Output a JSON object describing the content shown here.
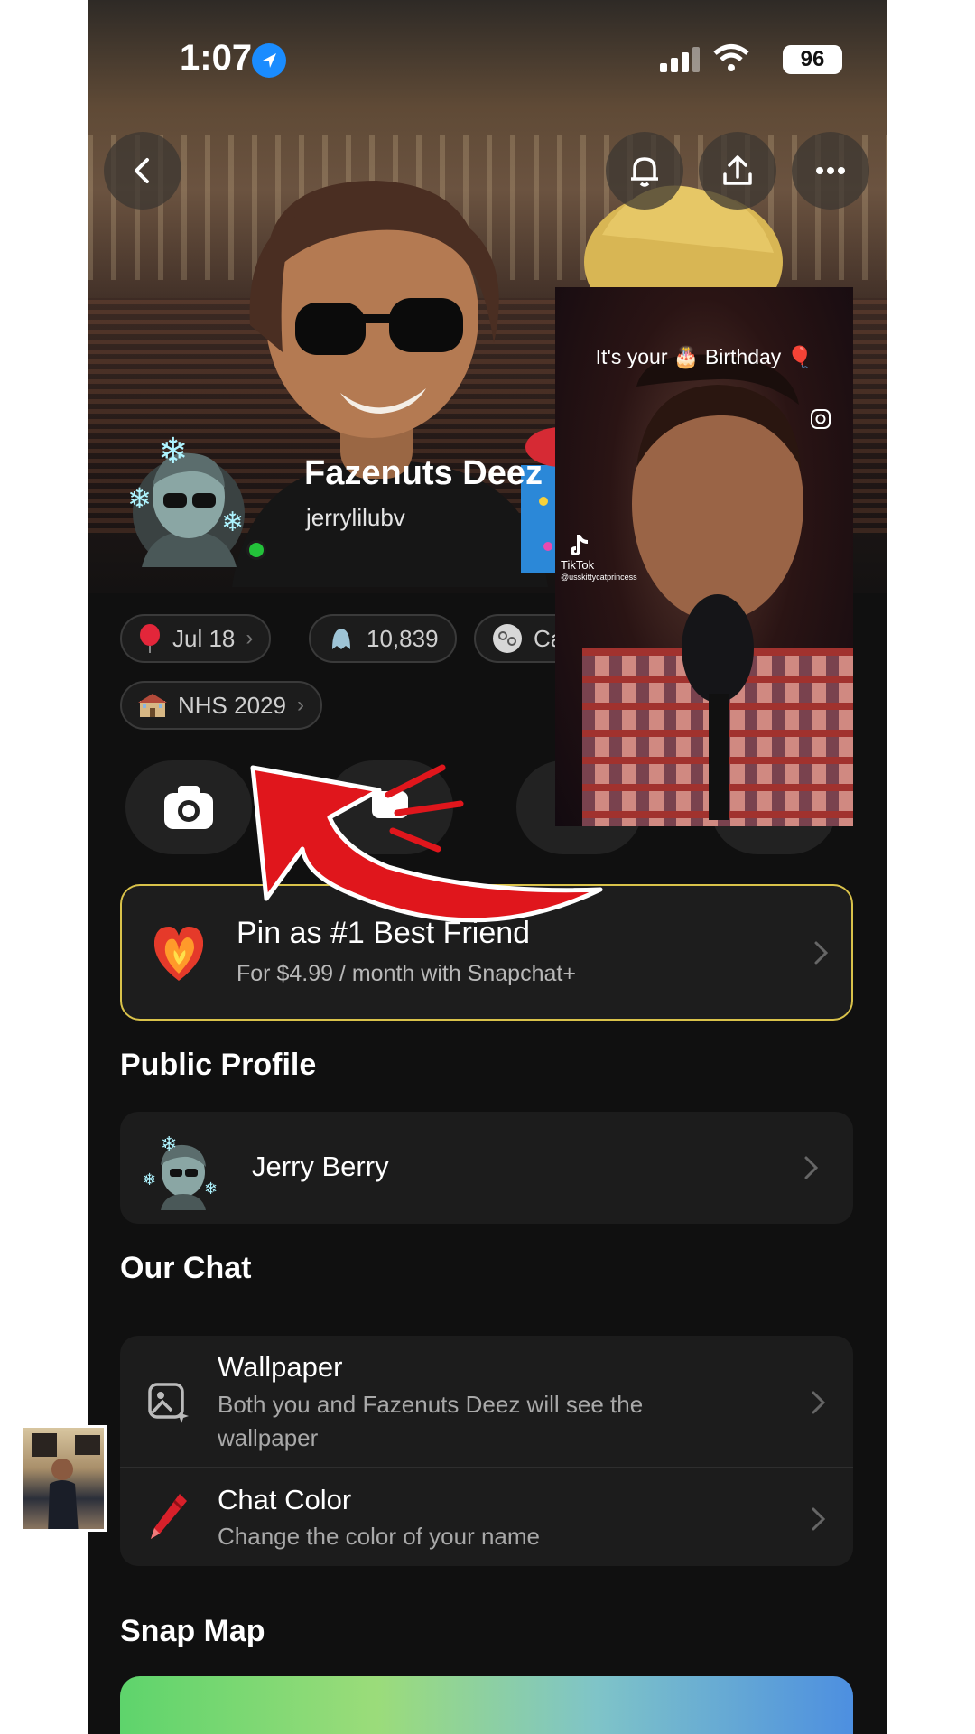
{
  "status_bar": {
    "time": "1:07",
    "battery": "96"
  },
  "profile": {
    "display_name": "Fazenuts Deez",
    "username": "jerrylilubv"
  },
  "chips": {
    "birthday": "Jul 18",
    "score": "10,839",
    "zodiac": "Ca",
    "school": "NHS 2029"
  },
  "snapchat_plus": {
    "title": "Pin as #1 Best Friend",
    "subtitle": "For $4.99 / month with Snapchat+"
  },
  "public_profile": {
    "section_title": "Public Profile",
    "name": "Jerry Berry"
  },
  "our_chat": {
    "section_title": "Our Chat",
    "wallpaper_title": "Wallpaper",
    "wallpaper_sub_line1": "Both you and Fazenuts Deez will see the",
    "wallpaper_sub_line2": "wallpaper",
    "chat_color_title": "Chat Color",
    "chat_color_sub": "Change the color of your name"
  },
  "snap_map": {
    "section_title": "Snap Map"
  },
  "tiktok_overlay": {
    "caption_prefix": "It's your",
    "caption_suffix": "Birthday",
    "brand": "TikTok",
    "handle": "@usskittycatprincess"
  },
  "icons": {
    "back": "chevron-left-icon",
    "notifications": "bell-icon",
    "share": "upload-icon",
    "more": "ellipsis-icon",
    "camera": "camera-icon"
  },
  "colors": {
    "online": "#23c23a",
    "plus_border": "#d9c24a",
    "annotation": "#e0161c"
  }
}
